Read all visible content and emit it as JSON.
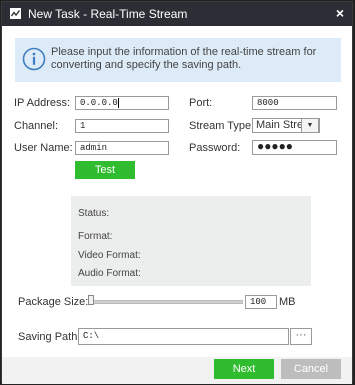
{
  "window": {
    "title": "New Task - Real-Time Stream",
    "close_label": "×"
  },
  "info": {
    "text": "Please input the information of the real-time stream for converting and specify the saving path."
  },
  "form": {
    "ip_label": "IP Address:",
    "ip_value": "0.0.0.0",
    "port_label": "Port:",
    "port_value": "8000",
    "channel_label": "Channel:",
    "channel_value": "1",
    "stream_type_label": "Stream Type:",
    "stream_type_value": "Main Stream",
    "user_label": "User Name:",
    "user_value": "admin",
    "password_label": "Password:",
    "password_value": "●●●●●",
    "test_label": "Test"
  },
  "status": {
    "status_label": "Status:",
    "format_label": "Format:",
    "video_label": "Video Format:",
    "audio_label": "Audio Format:"
  },
  "package": {
    "label": "Package Size:",
    "value": "100",
    "unit": "MB",
    "slider_fraction": 0.0
  },
  "saving": {
    "label": "Saving Path:",
    "value": "C:\\",
    "browse_label": "···"
  },
  "footer": {
    "next_label": "Next",
    "cancel_label": "Cancel"
  },
  "colors": {
    "title_bar": "#2b2f35",
    "accent_green": "#2fbd2f",
    "info_bg": "#ddebf8",
    "disabled": "#bdbdbd"
  }
}
